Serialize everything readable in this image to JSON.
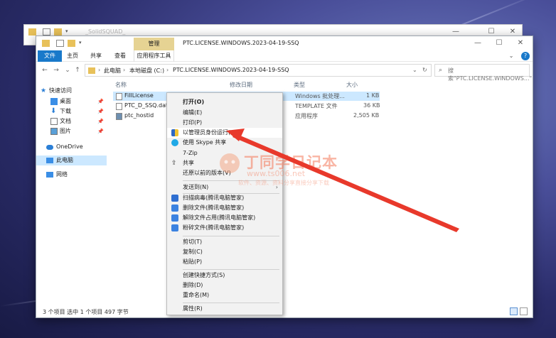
{
  "back_window": {
    "title": "_SolidSQUAD_",
    "controls": {
      "minimize": "—",
      "maximize": "☐",
      "close": "✕"
    }
  },
  "window": {
    "title": "PTC.LICENSE.WINDOWS.2023-04-19-SSQ",
    "contextual_tab_group": "管理",
    "controls": {
      "minimize": "—",
      "maximize": "☐",
      "close": "✕"
    }
  },
  "ribbon": {
    "file": "文件",
    "home": "主页",
    "share": "共享",
    "view": "查看",
    "app_tools": "应用程序工具",
    "collapse": "⌄",
    "help": "?"
  },
  "address_bar": {
    "breadcrumb": [
      "此电脑",
      "本地磁盘 (C:)",
      "PTC.LICENSE.WINDOWS.2023-04-19-SSQ"
    ],
    "search_placeholder": "搜索\"PTC.LICENSE.WINDOWS...\""
  },
  "nav_pane": {
    "items": [
      {
        "label": "快速访问",
        "icon": "star-icon"
      },
      {
        "label": "桌面",
        "icon": "desktop-icon",
        "pinned": true
      },
      {
        "label": "下载",
        "icon": "download-icon",
        "pinned": true
      },
      {
        "label": "文档",
        "icon": "document-icon",
        "pinned": true
      },
      {
        "label": "图片",
        "icon": "picture-icon",
        "pinned": true
      },
      {
        "label": "OneDrive",
        "icon": "cloud-icon"
      },
      {
        "label": "此电脑",
        "icon": "computer-icon",
        "selected": true
      },
      {
        "label": "网络",
        "icon": "network-icon"
      }
    ]
  },
  "file_list": {
    "columns": [
      "名称",
      "修改日期",
      "类型",
      "大小"
    ],
    "rows": [
      {
        "name": "FillLicense",
        "date": "",
        "type": "Windows 批处理...",
        "size": "1 KB",
        "selected": true
      },
      {
        "name": "PTC_D_SSQ.dat.te",
        "date": "",
        "type": "TEMPLATE 文件",
        "size": "36 KB"
      },
      {
        "name": "ptc_hostid",
        "date": "",
        "type": "应用程序",
        "size": "2,505 KB"
      }
    ]
  },
  "status_bar": {
    "text": "3 个项目    选中 1 个项目  497 字节"
  },
  "context_menu": {
    "items": [
      {
        "label": "打开(O)",
        "bold": true
      },
      {
        "label": "编辑(E)"
      },
      {
        "label": "打印(P)"
      },
      {
        "label": "以管理员身份运行(A)",
        "icon": "shield-icon",
        "highlighted": true
      },
      {
        "label": "使用 Skype 共享",
        "icon": "skype-icon"
      },
      {
        "label": "7-Zip",
        "submenu": true
      },
      {
        "label": "共享",
        "icon": "share-icon"
      },
      {
        "label": "还原以前的版本(V)"
      },
      {
        "label": "发送到(N)",
        "submenu": true
      },
      {
        "label": "扫描病毒(腾讯电脑管家)",
        "icon": "scan-icon"
      },
      {
        "label": "删除文件(腾讯电脑管家)",
        "icon": "delete-icon"
      },
      {
        "label": "解除文件占用(腾讯电脑管家)",
        "icon": "unlock-icon"
      },
      {
        "label": "粉碎文件(腾讯电脑管家)",
        "icon": "shred-icon"
      },
      {
        "label": "剪切(T)"
      },
      {
        "label": "复制(C)"
      },
      {
        "label": "粘贴(P)"
      },
      {
        "label": "创建快捷方式(S)"
      },
      {
        "label": "删除(D)"
      },
      {
        "label": "重命名(M)"
      },
      {
        "label": "属性(R)"
      }
    ]
  },
  "watermark": {
    "title": "丁同学日记本",
    "url": "www.ts006.net",
    "subtitle": "软件、资源、资料分享直接分享下载"
  },
  "annotation": {
    "color": "#e8392b"
  }
}
